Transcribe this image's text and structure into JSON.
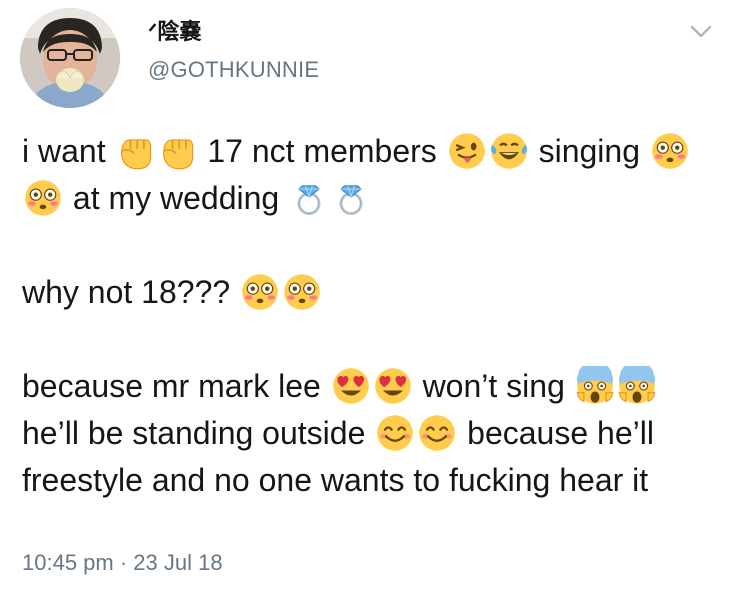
{
  "header": {
    "display_name": "ᐟ陰嚢",
    "handle": "@GOTHKUNNIE"
  },
  "tweet": {
    "p1_t1": "i want",
    "p1_t2": "17 nct members",
    "p1_t3": "singing",
    "p1_t4": "at my wedding",
    "p2_t1": "why not 18???",
    "p3_t1": "because mr mark lee",
    "p3_t2": "won’t sing",
    "p3_t3": "he’ll be standing outside",
    "p3_t4": "because he’ll freestyle and no one wants to fucking hear it"
  },
  "timestamp": "10:45 pm · 23 Jul 18",
  "icons": {
    "fist": "raised-fist-emoji",
    "tongue": "winking-face-with-tongue-emoji",
    "laugh": "face-with-tears-of-joy-emoji",
    "flushed": "flushed-face-emoji",
    "ring": "ring-emoji",
    "heart_eyes": "smiling-face-with-heart-eyes-emoji",
    "scream": "face-screaming-in-fear-emoji",
    "smile": "smiling-face-emoji"
  },
  "colors": {
    "text": "#14171a",
    "muted": "#657786",
    "emoji_yellow": "#ffcc4d"
  }
}
